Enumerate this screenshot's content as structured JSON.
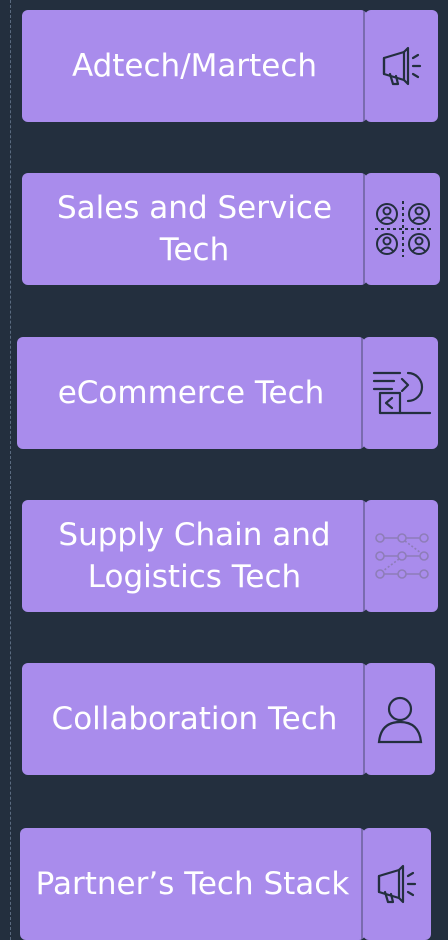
{
  "colors": {
    "background": "#232F3E",
    "card": "#A98CEC",
    "text": "#FFFFFF",
    "icon": "#232F3E"
  },
  "cards": [
    {
      "label": "Adtech/Martech",
      "icon": "megaphone-icon"
    },
    {
      "label": "Sales and Service Tech",
      "icon": "people-grid-icon"
    },
    {
      "label": "eCommerce Tech",
      "icon": "ecommerce-exchange-icon"
    },
    {
      "label": "Supply Chain and Logistics Tech",
      "icon": "network-nodes-icon"
    },
    {
      "label": "Collaboration Tech",
      "icon": "user-icon"
    },
    {
      "label": "Partner’s Tech Stack",
      "icon": "megaphone-icon"
    }
  ]
}
